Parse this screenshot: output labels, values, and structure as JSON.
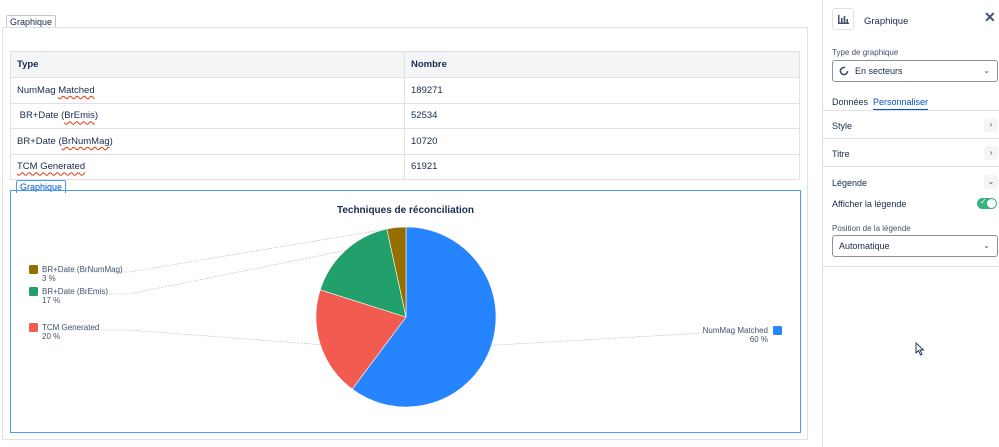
{
  "main": {
    "top_tab_label": "Graphique",
    "chart_tab_label": "Graphique"
  },
  "table": {
    "headers": [
      "Type",
      "Nombre"
    ],
    "rows": [
      {
        "type_plain": "NumMag ",
        "type_squig": "Matched",
        "type_after": "",
        "value": "189271"
      },
      {
        "type_plain": " BR+Date (",
        "type_squig": "BrEmis",
        "type_after": ")",
        "value": "52534"
      },
      {
        "type_plain": "BR+Date (",
        "type_squig": "BrNumMag",
        "type_after": ")",
        "value": "10720"
      },
      {
        "type_plain": "",
        "type_squig": "TCM Generated",
        "type_after": "",
        "value": "61921"
      }
    ]
  },
  "chart_data": {
    "type": "pie",
    "title": "Techniques de réconciliation",
    "slices": [
      {
        "label": "NumMag Matched",
        "value": 189271,
        "percent_label": "60 %",
        "color": "#2684ff"
      },
      {
        "label": "TCM Generated",
        "value": 61921,
        "percent_label": "20 %",
        "color": "#f15b50"
      },
      {
        "label": "BR+Date (BrEmis)",
        "value": 52534,
        "percent_label": "17 %",
        "color": "#22a06b"
      },
      {
        "label": "BR+Date (BrNumMag)",
        "value": 10720,
        "percent_label": "3 %",
        "color": "#946f00"
      }
    ],
    "legend": "beside slices"
  },
  "panel": {
    "title": "Graphique",
    "close_icon": "close-icon",
    "chart_type_label": "Type de graphique",
    "chart_type_value": "En secteurs",
    "tabs": [
      "Données",
      "Personnaliser"
    ],
    "active_tab": "Personnaliser",
    "sections": {
      "style": "Style",
      "titre": "Titre",
      "legende": "Légende"
    },
    "show_legend_label": "Afficher la légende",
    "show_legend": true,
    "legend_position_label": "Position de la légende",
    "legend_position_value": "Automatique",
    "accent_color": "#0052cc",
    "toggle_color": "#36b37e"
  }
}
